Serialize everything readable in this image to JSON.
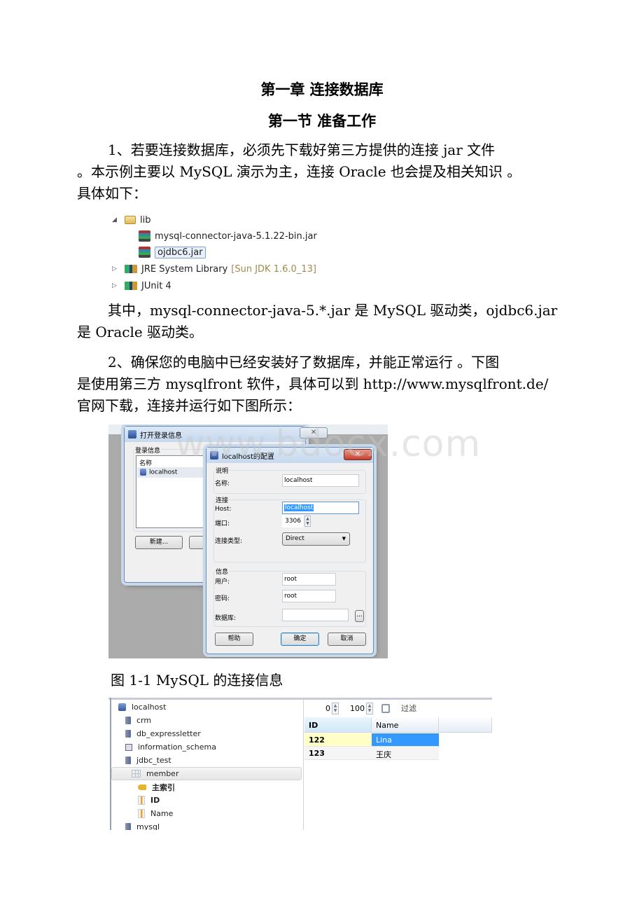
{
  "document": {
    "chapter_title": "第一章 连接数据库",
    "section_title": "第一节 准备工作",
    "para1": {
      "line1": "1、若要连接数据库，必须先下载好第三方提供的连接 jar 文件",
      "line2": "。本示例主要以 MySQL 演示为主，连接 Oracle 也会提及相关知识 。",
      "line3": "具体如下："
    },
    "para2": {
      "line1": "其中，mysql-connector-java-5.*.jar 是 MySQL 驱动类，ojdbc6.jar",
      "line2": "是 Oracle 驱动类。"
    },
    "para3": {
      "line1": "2、确保您的电脑中已经安装好了数据库，并能正常运行 。下图",
      "line2": "是使用第三方 mysqlfront 软件，具体可以到 http://www.mysqlfront.de/",
      "line3": "官网下载，连接并运行如下图所示："
    },
    "figure_caption": "图 1-1 MySQL 的连接信息",
    "watermark": "www.bdocx.com"
  },
  "eclipse_tree": {
    "lib_folder": "lib",
    "jar1": "mysql-connector-java-5.1.22-bin.jar",
    "jar2": "ojdbc6.jar",
    "jre_library": "JRE System Library",
    "jre_version": "[Sun JDK 1.6.0_13]",
    "junit": "JUnit 4"
  },
  "login_dialog": {
    "title": "打开登录信息",
    "group_label": "登录信息",
    "column_name": "名称",
    "entries": [
      "localhost"
    ],
    "new_button": "新建...",
    "close_glyph": "✕"
  },
  "config_dialog": {
    "title": "localhost的配置",
    "close_glyph": "✕",
    "description_group": "说明",
    "name_label": "名称:",
    "name_value": "localhost",
    "connection_group": "连接",
    "host_label": "Host:",
    "host_value": "localhost",
    "port_label": "端口:",
    "port_value": "3306",
    "conn_type_label": "连接类型:",
    "conn_type_value": "Direct",
    "info_group": "信息",
    "user_label": "用户:",
    "user_value": "root",
    "password_label": "密码:",
    "password_value": "root",
    "database_label": "数据库:",
    "database_value": "",
    "browse_button": "...",
    "help_button": "帮助",
    "ok_button": "确定",
    "cancel_button": "取消"
  },
  "mysqlfront": {
    "tree": {
      "host": "localhost",
      "databases": [
        "crm",
        "db_expressletter",
        "information_schema",
        "jdbc_test"
      ],
      "table": "member",
      "primary_index": "主索引",
      "columns": [
        "ID",
        "Name"
      ],
      "next_database": "mysql"
    },
    "toolbar": {
      "offset": "0",
      "limit": "100",
      "filter_label": "过滤"
    },
    "grid": {
      "headers": [
        "ID",
        "Name"
      ],
      "rows": [
        {
          "id": "122",
          "name": "Lina"
        },
        {
          "id": "123",
          "name": "王庆"
        }
      ]
    }
  }
}
